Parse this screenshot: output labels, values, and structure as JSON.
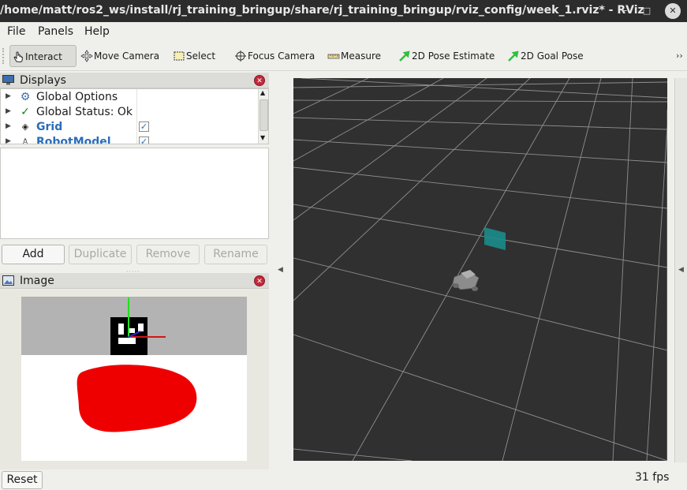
{
  "window": {
    "title": "/home/matt/ros2_ws/install/rj_training_bringup/share/rj_training_bringup/rviz_config/week_1.rviz* - RViz",
    "minimize_glyph": "–",
    "maximize_glyph": "□",
    "close_glyph": "✕"
  },
  "menu": {
    "file": "File",
    "panels": "Panels",
    "help": "Help"
  },
  "toolbar": {
    "interact": "Interact",
    "move_camera": "Move Camera",
    "select": "Select",
    "focus_camera": "Focus Camera",
    "measure": "Measure",
    "pose_estimate": "2D Pose Estimate",
    "goal_pose": "2D Goal Pose",
    "overflow": "››",
    "accent_color": "#2fbf3c"
  },
  "displays": {
    "title": "Displays",
    "items": [
      {
        "label": "Global Options",
        "icon": "gear-icon",
        "checked": null
      },
      {
        "label": "Global Status: Ok",
        "icon": "checkmark-icon",
        "checked": null
      },
      {
        "label": "Grid",
        "icon": "grid-icon",
        "checked": true
      },
      {
        "label": "RobotModel",
        "icon": "robot-icon",
        "checked": true
      }
    ],
    "buttons": {
      "add": "Add",
      "duplicate": "Duplicate",
      "remove": "Remove",
      "rename": "Rename"
    }
  },
  "image_panel": {
    "title": "Image"
  },
  "status": {
    "reset": "Reset",
    "fps": "31 fps"
  },
  "colors": {
    "viewport_bg": "#303030",
    "grid_line": "#a0a0a0",
    "marker": "#1b8c8c",
    "link_blue": "#2a6db8",
    "close_red": "#c0293b"
  }
}
